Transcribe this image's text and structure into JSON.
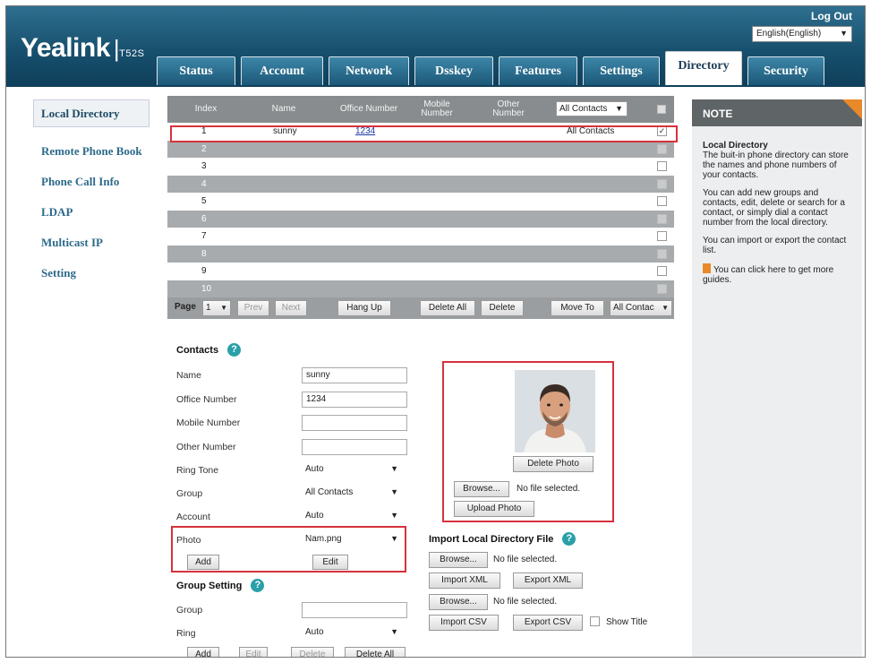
{
  "header": {
    "brand": "Yealink",
    "separator": "|",
    "model": "T52S",
    "logout": "Log Out",
    "language": "English(English)"
  },
  "tabs": [
    {
      "label": "Status"
    },
    {
      "label": "Account"
    },
    {
      "label": "Network"
    },
    {
      "label": "Dsskey"
    },
    {
      "label": "Features"
    },
    {
      "label": "Settings"
    },
    {
      "label": "Directory"
    },
    {
      "label": "Security"
    }
  ],
  "sidebar": {
    "items": [
      {
        "label": "Local Directory"
      },
      {
        "label": "Remote Phone Book"
      },
      {
        "label": "Phone Call Info"
      },
      {
        "label": "LDAP"
      },
      {
        "label": "Multicast IP"
      },
      {
        "label": "Setting"
      }
    ]
  },
  "table": {
    "headers": {
      "index": "Index",
      "name": "Name",
      "office": "Office Number",
      "mobile": "Mobile Number",
      "other": "Other Number"
    },
    "filter": "All Contacts",
    "rows": [
      {
        "index": "1",
        "name": "sunny",
        "office": "1234",
        "group": "All Contacts",
        "checked": "✓"
      },
      {
        "index": "2",
        "name": "",
        "office": "",
        "group": "",
        "checked": ""
      },
      {
        "index": "3",
        "name": "",
        "office": "",
        "group": "",
        "checked": ""
      },
      {
        "index": "4",
        "name": "",
        "office": "",
        "group": "",
        "checked": ""
      },
      {
        "index": "5",
        "name": "",
        "office": "",
        "group": "",
        "checked": ""
      },
      {
        "index": "6",
        "name": "",
        "office": "",
        "group": "",
        "checked": ""
      },
      {
        "index": "7",
        "name": "",
        "office": "",
        "group": "",
        "checked": ""
      },
      {
        "index": "8",
        "name": "",
        "office": "",
        "group": "",
        "checked": ""
      },
      {
        "index": "9",
        "name": "",
        "office": "",
        "group": "",
        "checked": ""
      },
      {
        "index": "10",
        "name": "",
        "office": "",
        "group": "",
        "checked": ""
      }
    ],
    "pager": {
      "page_label": "Page",
      "page_value": "1",
      "prev": "Prev",
      "next": "Next",
      "hang_up": "Hang Up",
      "delete_all": "Delete All",
      "delete": "Delete",
      "move_to": "Move To",
      "move_target": "All Contac"
    }
  },
  "contacts": {
    "title": "Contacts",
    "help": "?",
    "fields": {
      "name_label": "Name",
      "name_value": "sunny",
      "office_label": "Office Number",
      "office_value": "1234",
      "mobile_label": "Mobile Number",
      "mobile_value": "",
      "other_label": "Other Number",
      "other_value": "",
      "ringtone_label": "Ring Tone",
      "ringtone_value": "Auto",
      "group_label": "Group",
      "group_value": "All Contacts",
      "account_label": "Account",
      "account_value": "Auto",
      "photo_label": "Photo",
      "photo_value": "Nam.png"
    },
    "add": "Add",
    "edit": "Edit"
  },
  "group_setting": {
    "title": "Group Setting",
    "help": "?",
    "group_label": "Group",
    "group_value": "",
    "ring_label": "Ring",
    "ring_value": "Auto",
    "add": "Add",
    "edit": "Edit",
    "delete": "Delete",
    "delete_all": "Delete All"
  },
  "photo_panel": {
    "delete_photo": "Delete Photo",
    "browse": "Browse...",
    "no_file": "No file selected.",
    "upload": "Upload Photo"
  },
  "import": {
    "title": "Import Local Directory File",
    "help": "?",
    "browse1": "Browse...",
    "no_file1": "No file selected.",
    "import_xml": "Import XML",
    "export_xml": "Export XML",
    "browse2": "Browse...",
    "no_file2": "No file selected.",
    "import_csv": "Import CSV",
    "export_csv": "Export CSV",
    "show_title": "Show Title"
  },
  "note": {
    "title": "NOTE",
    "heading": "Local Directory",
    "p1": "The buit-in phone directory can store the names and phone numbers of your contacts.",
    "p2": "You can add new groups and contacts, edit, delete or search for a contact, or simply dial a contact number from the local directory.",
    "p3": "You can import or export the contact list.",
    "p4": "You can click here to get more guides."
  },
  "colors": {
    "header_bg": "#17506e",
    "accent_red": "#d6323c",
    "help_icon": "#29a0a8",
    "note_corner": "#e8892a"
  }
}
